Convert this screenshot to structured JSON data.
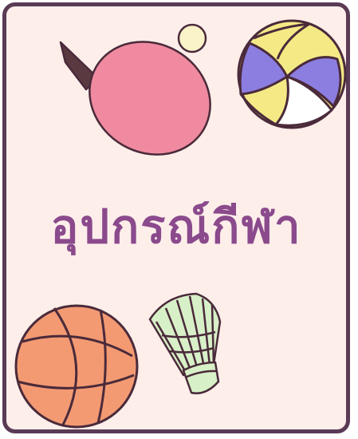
{
  "card": {
    "title": "อุปกรณ์กีฬา",
    "title_color": "#8a4a8c",
    "border_color": "#5a3a55",
    "background_color": "#fdeeea"
  },
  "illustrations": [
    {
      "name": "table-tennis-paddle",
      "color": "#f08aa0"
    },
    {
      "name": "ping-pong-ball",
      "color": "#fbf3c8"
    },
    {
      "name": "volleyball",
      "colors": [
        "#f3ea86",
        "#8c7ee0",
        "#ffffff"
      ]
    },
    {
      "name": "basketball",
      "color": "#f39a73"
    },
    {
      "name": "shuttlecock",
      "color": "#d8f0c8"
    }
  ]
}
